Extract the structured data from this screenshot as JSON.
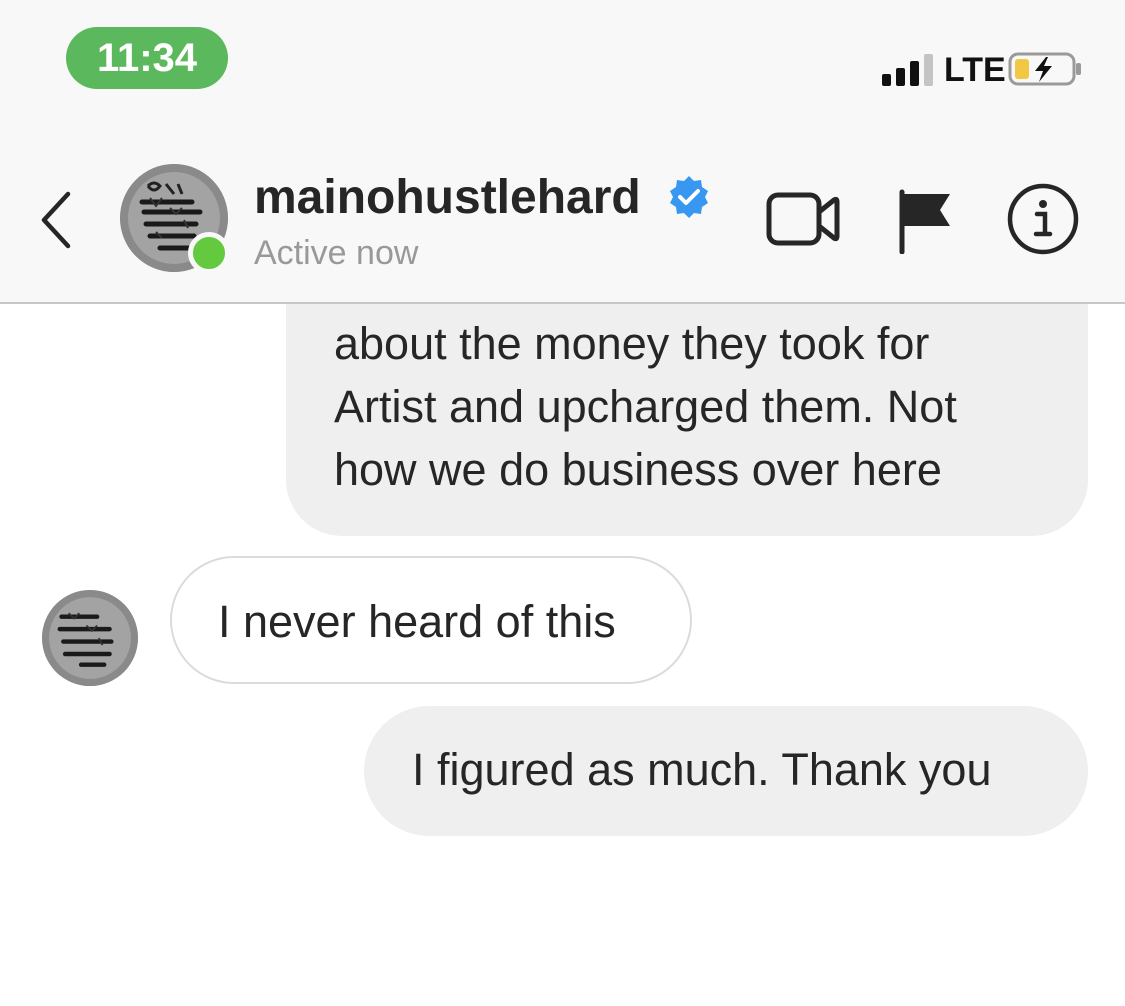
{
  "status_bar": {
    "time": "11:34",
    "network": "LTE",
    "signal_bars_active": 3,
    "signal_bars_total": 4,
    "battery_charging": true,
    "accent_color": "#5cb85c"
  },
  "header": {
    "back_icon": "chevron-left-icon",
    "username": "mainohustlehard",
    "verified": true,
    "status": "Active now",
    "actions": [
      {
        "icon": "video-camera-icon"
      },
      {
        "icon": "flag-icon"
      },
      {
        "icon": "info-icon"
      }
    ]
  },
  "messages": [
    {
      "direction": "outgoing",
      "text": "about the money they took for\nArtist and upcharged them. Not\nhow we do business over here"
    },
    {
      "direction": "incoming",
      "text": "I never heard of this"
    },
    {
      "direction": "outgoing",
      "text": "I figured as much. Thank you"
    }
  ],
  "colors": {
    "online": "#63c93f",
    "verified": "#3897f0",
    "outgoing_bubble": "#efefef",
    "incoming_border": "#dbdbdb"
  }
}
